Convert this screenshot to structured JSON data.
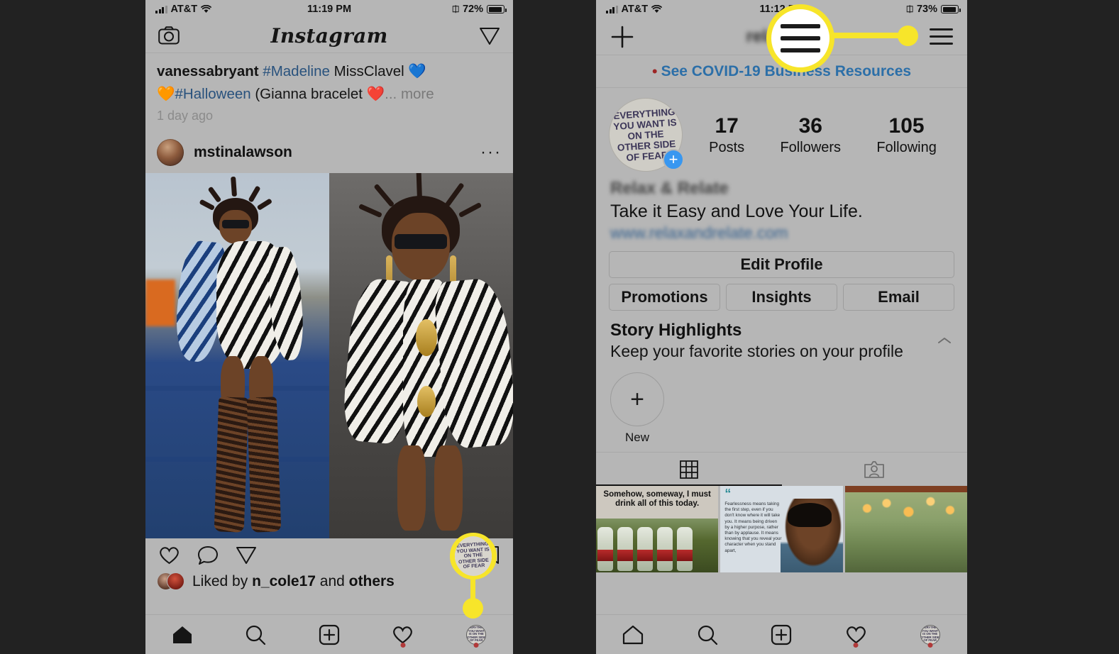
{
  "meta": {
    "background_color": "#222222",
    "ui_color": "#b6b6b6",
    "accent_yellow": "#f7e52a",
    "link_blue": "#2c6fa8",
    "instagram_blue": "#3897f0"
  },
  "left_phone": {
    "status_bar": {
      "carrier": "AT&T",
      "time": "11:19 PM",
      "battery_percent": "72%",
      "wifi_icon": "wifi-icon",
      "signal_icon": "signal-bars-icon",
      "battery_icon": "battery-icon",
      "lock_icon": "rotation-lock-icon"
    },
    "top_bar": {
      "camera_icon": "camera-icon",
      "logo": "Instagram",
      "direct_icon": "paper-plane-icon"
    },
    "post_caption": {
      "username": "vanessabryant",
      "hashtag_1": "#Madeline",
      "text_1": "MissClavel",
      "emoji_1": "💙",
      "emoji_2": "🧡",
      "hashtag_2": "#Halloween",
      "text_2": "(Gianna bracelet",
      "emoji_3": "❤️",
      "ellipsis": "...",
      "more": "more",
      "timestamp": "1 day ago"
    },
    "post_header": {
      "username": "mstinalawson",
      "avatar_icon": "user-avatar",
      "options_icon": "more-options-icon"
    },
    "post_actions": {
      "like_icon": "heart-icon",
      "comment_icon": "comment-bubble-icon",
      "share_icon": "paper-plane-icon",
      "save_icon": "bookmark-icon"
    },
    "liked_by": {
      "prefix": "Liked by ",
      "user": "n_cole17",
      "middle": " and ",
      "suffix": "others"
    },
    "tab_bar": [
      {
        "name": "home-tab",
        "icon": "home-icon",
        "badge": false
      },
      {
        "name": "search-tab",
        "icon": "search-icon",
        "badge": false
      },
      {
        "name": "add-post-tab",
        "icon": "plus-square-icon",
        "badge": false
      },
      {
        "name": "activity-tab",
        "icon": "heart-icon",
        "badge": true
      },
      {
        "name": "profile-tab",
        "icon": "profile-avatar-icon",
        "badge": true
      }
    ],
    "callout": {
      "target": "profile-tab-avatar",
      "avatar_text": "EVERYTHING YOU WANT IS ON THE OTHER SIDE OF FEAR"
    }
  },
  "right_phone": {
    "status_bar": {
      "carrier": "AT&T",
      "time": "11:12 PM",
      "battery_percent": "73%",
      "wifi_icon": "wifi-icon",
      "signal_icon": "signal-bars-icon",
      "battery_icon": "battery-icon",
      "lock_icon": "rotation-lock-icon"
    },
    "top_bar": {
      "add_icon": "plus-icon",
      "title": "relaxn",
      "menu_icon": "hamburger-menu-icon"
    },
    "covid_banner": {
      "bullet": "•",
      "label": "See COVID-19 Business Resources"
    },
    "profile": {
      "avatar_text": "EVERYTHING YOU WANT IS ON THE OTHER SIDE OF FEAR",
      "add_story_icon": "plus-badge-icon",
      "stats": [
        {
          "number": "17",
          "label": "Posts"
        },
        {
          "number": "36",
          "label": "Followers"
        },
        {
          "number": "105",
          "label": "Following"
        }
      ],
      "business_name": "Relax & Relate",
      "tagline": "Take it Easy and Love Your Life.",
      "website": "www.relaxandrelate.com"
    },
    "buttons": {
      "edit_profile": "Edit Profile",
      "promotions": "Promotions",
      "insights": "Insights",
      "email": "Email"
    },
    "story_highlights": {
      "title": "Story Highlights",
      "subtitle": "Keep your favorite stories on your profile",
      "collapse_icon": "chevron-up-icon",
      "new_label": "New",
      "new_icon": "plus-icon",
      "placeholder_count": 4
    },
    "content_tabs": [
      {
        "name": "grid-tab",
        "icon": "grid-icon",
        "active": true
      },
      {
        "name": "tagged-tab",
        "icon": "tagged-person-icon",
        "active": false
      }
    ],
    "posts_grid": [
      {
        "name": "post-water-bottles",
        "caption": "Somehow, someway, I must drink all of this today."
      },
      {
        "name": "post-fearlessness-quote",
        "quote_mark": "“",
        "body": "Fearlessness means taking the first step, even if you don't know where it will take you. It means being driven by a higher purpose, rather than by applause. It means knowing that you reveal your character when you stand apart,"
      },
      {
        "name": "post-string-lights",
        "caption": ""
      }
    ],
    "tab_bar": [
      {
        "name": "home-tab",
        "icon": "home-icon",
        "badge": false
      },
      {
        "name": "search-tab",
        "icon": "search-icon",
        "badge": false
      },
      {
        "name": "add-post-tab",
        "icon": "plus-square-icon",
        "badge": false
      },
      {
        "name": "activity-tab",
        "icon": "heart-icon",
        "badge": true
      },
      {
        "name": "profile-tab",
        "icon": "profile-avatar-icon",
        "badge": true
      }
    ],
    "callout": {
      "target": "hamburger-menu-icon",
      "icon": "hamburger-menu-icon"
    }
  }
}
